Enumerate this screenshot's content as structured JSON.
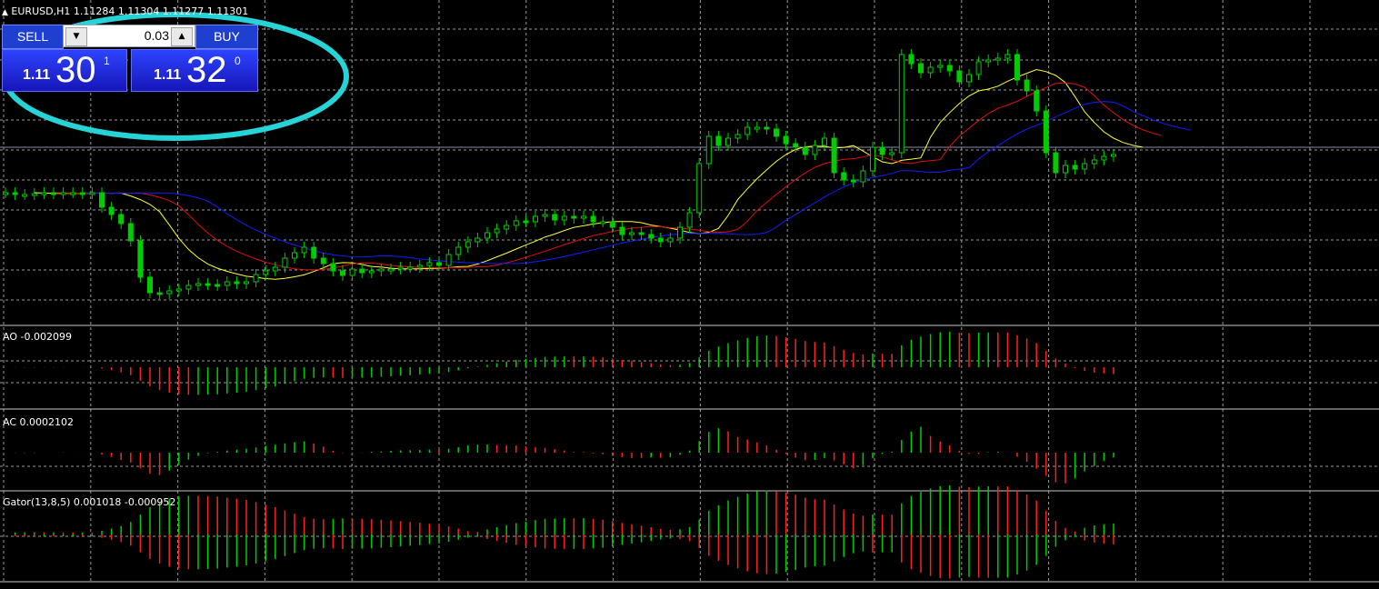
{
  "window": {
    "header_arrow": "▲",
    "symbol_timeframe": "EURUSD,H1",
    "ohlc": "1.11284 1.11304 1.11277 1.11301"
  },
  "trade_panel": {
    "sell_label": "SELL",
    "buy_label": "BUY",
    "lot_value": "0.03",
    "sell_price": {
      "big": "1.11",
      "main": "30",
      "sup": "1"
    },
    "buy_price": {
      "big": "1.11",
      "main": "32",
      "sup": "0"
    }
  },
  "indicators": {
    "ao_label": "AO -0.002099",
    "ac_label": "AC 0.0002102",
    "gator_label": "Gator(13,8,5) 0.001018 -0.000952"
  },
  "colors": {
    "grid": "#9a9a9a",
    "bull": "#00cc00",
    "bear": "#ff2020",
    "alligator_lips": "#ffff33",
    "alligator_teeth": "#e01010",
    "alligator_jaw": "#1020ff",
    "highlight_ellipse": "#26d3d6"
  },
  "chart_data": {
    "type": "line",
    "series": [
      {
        "name": "EURUSD,H1",
        "values": [
          212,
          214,
          214,
          213,
          212,
          213,
          212,
          212,
          213,
          212,
          228,
          236,
          246,
          265,
          305,
          322,
          323,
          320,
          318,
          314,
          312,
          313,
          314,
          310,
          312,
          310,
          302,
          298,
          294,
          284,
          278,
          272,
          284,
          290,
          298,
          303,
          296,
          300,
          298,
          296,
          296,
          294,
          294,
          292,
          289,
          292,
          280,
          272,
          266,
          262,
          256,
          252,
          248,
          243,
          244,
          238,
          236,
          242,
          238,
          240,
          238,
          244,
          244,
          250,
          258,
          256,
          258,
          262,
          266,
          262,
          250,
          234,
          180,
          150,
          160,
          152,
          148,
          140,
          140,
          142,
          150,
          158,
          162,
          170,
          160,
          152,
          190,
          198,
          200,
          188,
          162,
          170,
          168,
          60,
          70,
          80,
          74,
          72,
          78,
          90,
          82,
          68,
          66,
          64,
          60,
          88,
          100,
          122,
          168,
          190,
          182,
          186,
          180,
          176,
          172,
          170
        ]
      }
    ]
  }
}
